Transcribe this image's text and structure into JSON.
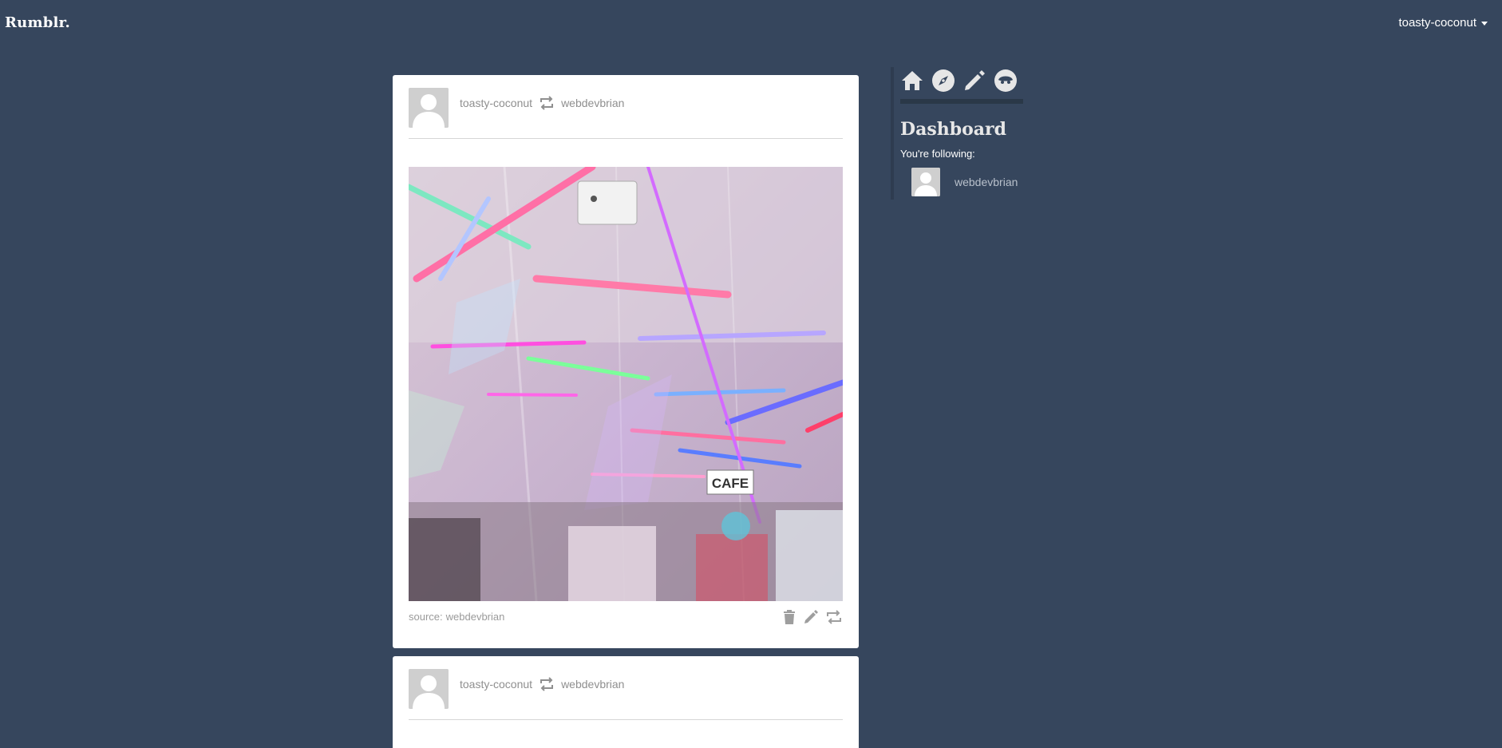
{
  "app": {
    "logo": "Rumblr."
  },
  "header": {
    "username": "toasty-coconut"
  },
  "colors": {
    "background": "#36465d",
    "card": "#ffffff",
    "meta_text": "#8f8f8f",
    "icon_gray": "#9e9e9e"
  },
  "posts": [
    {
      "author": "toasty-coconut",
      "reblog_icon": "reblog-icon",
      "reblogged_from": "webdevbrian",
      "image_alt": "Neon-lit store interior",
      "image_sign": "CAFE",
      "source_label": "source:",
      "source_name": "webdevbrian",
      "actions": [
        "trash-icon",
        "edit-icon",
        "reblog-icon"
      ]
    },
    {
      "author": "toasty-coconut",
      "reblog_icon": "reblog-icon",
      "reblogged_from": "webdevbrian"
    }
  ],
  "sidebar": {
    "nav": [
      "home-icon",
      "explore-icon",
      "create-post-icon",
      "profile-icon"
    ],
    "title": "Dashboard",
    "following_label": "You're following:",
    "following": [
      {
        "name": "webdevbrian"
      }
    ]
  }
}
